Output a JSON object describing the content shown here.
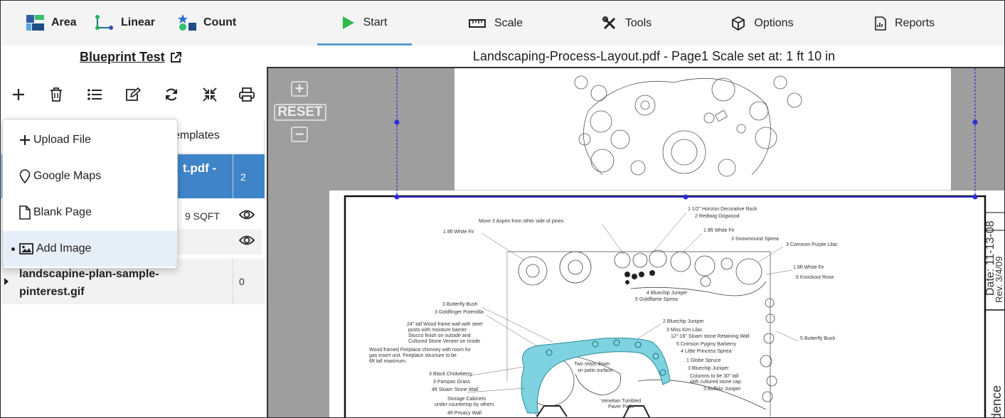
{
  "measure_tools": [
    {
      "label": "Area",
      "icon": "area-icon"
    },
    {
      "label": "Linear",
      "icon": "linear-icon"
    },
    {
      "label": "Count",
      "icon": "count-icon"
    }
  ],
  "nav_tabs": [
    {
      "label": "Start",
      "icon": "play-icon",
      "active": true
    },
    {
      "label": "Scale",
      "icon": "ruler-icon"
    },
    {
      "label": "Tools",
      "icon": "tools-icon"
    },
    {
      "label": "Options",
      "icon": "cube-icon"
    },
    {
      "label": "Reports",
      "icon": "report-icon"
    }
  ],
  "project": {
    "title": "Blueprint Test",
    "link_icon": "external-link-icon"
  },
  "toolbar": [
    "add-icon",
    "trash-icon",
    "list-icon",
    "edit-icon",
    "refresh-icon",
    "collapse-icon",
    "print-icon"
  ],
  "tabs": {
    "templates_partial": "emplates"
  },
  "files": {
    "selected": {
      "name_partial": "t.pdf -",
      "count": "2"
    },
    "measure_partial": "9 SQFT",
    "second": {
      "name": "landscapine-plan-sample-pinterest.gif",
      "count": "0"
    }
  },
  "add_menu": {
    "items": [
      {
        "label": "Upload File",
        "icon": "plus-icon"
      },
      {
        "label": "Google Maps",
        "icon": "map-pin-icon"
      },
      {
        "label": "Blank Page",
        "icon": "page-icon"
      },
      {
        "label": "Add Image",
        "icon": "image-icon",
        "highlighted": true
      }
    ]
  },
  "viewer": {
    "title": "Landscaping-Process-Layout.pdf - Page1 Scale set at: 1 ft 10 in",
    "reset_label": "RESET",
    "zoom_in": "+",
    "zoom_out": "−"
  },
  "colors": {
    "accent": "#3f84c8",
    "tab_underline": "#5b9bd5",
    "highlight_shape": "#7fd3e0",
    "scale_line": "#2b2fd1",
    "start_icon": "#2db84f"
  }
}
